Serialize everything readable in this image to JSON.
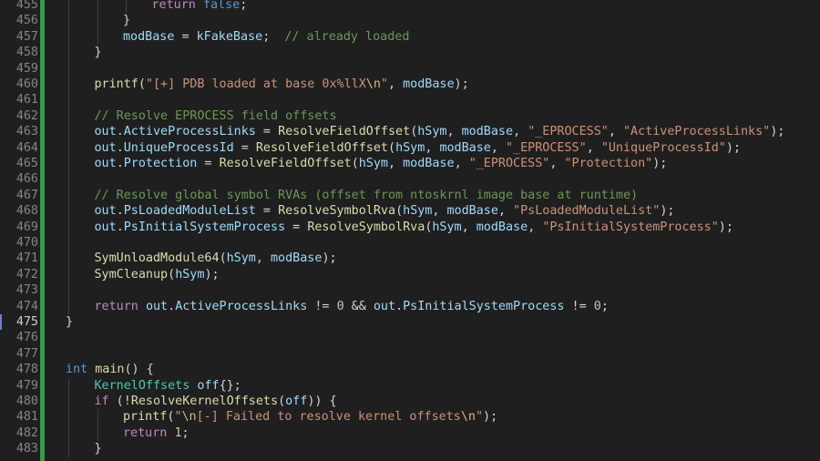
{
  "editor": {
    "git_bar_color": "#2ea043",
    "active_line": "475",
    "lines": [
      {
        "n": "455",
        "indent": 3,
        "tokens": [
          [
            "ctl",
            "return"
          ],
          [
            "plain",
            " "
          ],
          [
            "kw",
            "false"
          ],
          [
            "plain",
            ";"
          ]
        ]
      },
      {
        "n": "456",
        "indent": 2,
        "tokens": [
          [
            "plain",
            "}"
          ]
        ]
      },
      {
        "n": "457",
        "indent": 2,
        "tokens": [
          [
            "var",
            "modBase"
          ],
          [
            "plain",
            " = "
          ],
          [
            "var",
            "kFakeBase"
          ],
          [
            "plain",
            ";  "
          ],
          [
            "com",
            "// already loaded"
          ]
        ]
      },
      {
        "n": "458",
        "indent": 1,
        "tokens": [
          [
            "plain",
            "}"
          ]
        ]
      },
      {
        "n": "459",
        "indent": 0,
        "tokens": []
      },
      {
        "n": "460",
        "indent": 1,
        "tokens": [
          [
            "fn",
            "printf"
          ],
          [
            "plain",
            "("
          ],
          [
            "str",
            "\"[+] PDB loaded at base 0x%llX"
          ],
          [
            "esc",
            "\\n"
          ],
          [
            "str",
            "\""
          ],
          [
            "plain",
            ", "
          ],
          [
            "var",
            "modBase"
          ],
          [
            "plain",
            ");"
          ]
        ]
      },
      {
        "n": "461",
        "indent": 0,
        "tokens": []
      },
      {
        "n": "462",
        "indent": 1,
        "tokens": [
          [
            "com",
            "// Resolve EPROCESS field offsets"
          ]
        ]
      },
      {
        "n": "463",
        "indent": 1,
        "tokens": [
          [
            "var",
            "out"
          ],
          [
            "plain",
            "."
          ],
          [
            "var",
            "ActiveProcessLinks"
          ],
          [
            "plain",
            " = "
          ],
          [
            "fn",
            "ResolveFieldOffset"
          ],
          [
            "plain",
            "("
          ],
          [
            "var",
            "hSym"
          ],
          [
            "plain",
            ", "
          ],
          [
            "var",
            "modBase"
          ],
          [
            "plain",
            ", "
          ],
          [
            "str",
            "\"_EPROCESS\""
          ],
          [
            "plain",
            ", "
          ],
          [
            "str",
            "\"ActiveProcessLinks\""
          ],
          [
            "plain",
            ");"
          ]
        ]
      },
      {
        "n": "464",
        "indent": 1,
        "tokens": [
          [
            "var",
            "out"
          ],
          [
            "plain",
            "."
          ],
          [
            "var",
            "UniqueProcessId"
          ],
          [
            "plain",
            " = "
          ],
          [
            "fn",
            "ResolveFieldOffset"
          ],
          [
            "plain",
            "("
          ],
          [
            "var",
            "hSym"
          ],
          [
            "plain",
            ", "
          ],
          [
            "var",
            "modBase"
          ],
          [
            "plain",
            ", "
          ],
          [
            "str",
            "\"_EPROCESS\""
          ],
          [
            "plain",
            ", "
          ],
          [
            "str",
            "\"UniqueProcessId\""
          ],
          [
            "plain",
            ");"
          ]
        ]
      },
      {
        "n": "465",
        "indent": 1,
        "tokens": [
          [
            "var",
            "out"
          ],
          [
            "plain",
            "."
          ],
          [
            "var",
            "Protection"
          ],
          [
            "plain",
            " = "
          ],
          [
            "fn",
            "ResolveFieldOffset"
          ],
          [
            "plain",
            "("
          ],
          [
            "var",
            "hSym"
          ],
          [
            "plain",
            ", "
          ],
          [
            "var",
            "modBase"
          ],
          [
            "plain",
            ", "
          ],
          [
            "str",
            "\"_EPROCESS\""
          ],
          [
            "plain",
            ", "
          ],
          [
            "str",
            "\"Protection\""
          ],
          [
            "plain",
            ");"
          ]
        ]
      },
      {
        "n": "466",
        "indent": 0,
        "tokens": []
      },
      {
        "n": "467",
        "indent": 1,
        "tokens": [
          [
            "com",
            "// Resolve global symbol RVAs (offset from ntoskrnl image base at runtime)"
          ]
        ]
      },
      {
        "n": "468",
        "indent": 1,
        "tokens": [
          [
            "var",
            "out"
          ],
          [
            "plain",
            "."
          ],
          [
            "var",
            "PsLoadedModuleList"
          ],
          [
            "plain",
            " = "
          ],
          [
            "fn",
            "ResolveSymbolRva"
          ],
          [
            "plain",
            "("
          ],
          [
            "var",
            "hSym"
          ],
          [
            "plain",
            ", "
          ],
          [
            "var",
            "modBase"
          ],
          [
            "plain",
            ", "
          ],
          [
            "str",
            "\"PsLoadedModuleList\""
          ],
          [
            "plain",
            ");"
          ]
        ]
      },
      {
        "n": "469",
        "indent": 1,
        "tokens": [
          [
            "var",
            "out"
          ],
          [
            "plain",
            "."
          ],
          [
            "var",
            "PsInitialSystemProcess"
          ],
          [
            "plain",
            " = "
          ],
          [
            "fn",
            "ResolveSymbolRva"
          ],
          [
            "plain",
            "("
          ],
          [
            "var",
            "hSym"
          ],
          [
            "plain",
            ", "
          ],
          [
            "var",
            "modBase"
          ],
          [
            "plain",
            ", "
          ],
          [
            "str",
            "\"PsInitialSystemProcess\""
          ],
          [
            "plain",
            ");"
          ]
        ]
      },
      {
        "n": "470",
        "indent": 0,
        "tokens": []
      },
      {
        "n": "471",
        "indent": 1,
        "tokens": [
          [
            "fn",
            "SymUnloadModule64"
          ],
          [
            "plain",
            "("
          ],
          [
            "var",
            "hSym"
          ],
          [
            "plain",
            ", "
          ],
          [
            "var",
            "modBase"
          ],
          [
            "plain",
            ");"
          ]
        ]
      },
      {
        "n": "472",
        "indent": 1,
        "tokens": [
          [
            "fn",
            "SymCleanup"
          ],
          [
            "plain",
            "("
          ],
          [
            "var",
            "hSym"
          ],
          [
            "plain",
            ");"
          ]
        ]
      },
      {
        "n": "473",
        "indent": 0,
        "tokens": []
      },
      {
        "n": "474",
        "indent": 1,
        "tokens": [
          [
            "ctl",
            "return"
          ],
          [
            "plain",
            " "
          ],
          [
            "var",
            "out"
          ],
          [
            "plain",
            "."
          ],
          [
            "var",
            "ActiveProcessLinks"
          ],
          [
            "plain",
            " != "
          ],
          [
            "num",
            "0"
          ],
          [
            "plain",
            " && "
          ],
          [
            "var",
            "out"
          ],
          [
            "plain",
            "."
          ],
          [
            "var",
            "PsInitialSystemProcess"
          ],
          [
            "plain",
            " != "
          ],
          [
            "num",
            "0"
          ],
          [
            "plain",
            ";"
          ]
        ]
      },
      {
        "n": "475",
        "indent": 0,
        "tokens": [
          [
            "plain",
            "}"
          ]
        ]
      },
      {
        "n": "476",
        "indent": 0,
        "tokens": []
      },
      {
        "n": "477",
        "indent": 0,
        "tokens": []
      },
      {
        "n": "478",
        "indent": 0,
        "tokens": [
          [
            "kw",
            "int"
          ],
          [
            "plain",
            " "
          ],
          [
            "fn",
            "main"
          ],
          [
            "plain",
            "() {"
          ]
        ]
      },
      {
        "n": "479",
        "indent": 1,
        "tokens": [
          [
            "type",
            "KernelOffsets"
          ],
          [
            "plain",
            " "
          ],
          [
            "var",
            "off"
          ],
          [
            "plain",
            "{};"
          ]
        ]
      },
      {
        "n": "480",
        "indent": 1,
        "tokens": [
          [
            "ctl",
            "if"
          ],
          [
            "plain",
            " (!"
          ],
          [
            "fn",
            "ResolveKernelOffsets"
          ],
          [
            "plain",
            "("
          ],
          [
            "var",
            "off"
          ],
          [
            "plain",
            ")) {"
          ]
        ]
      },
      {
        "n": "481",
        "indent": 2,
        "tokens": [
          [
            "fn",
            "printf"
          ],
          [
            "plain",
            "("
          ],
          [
            "str",
            "\""
          ],
          [
            "esc",
            "\\n"
          ],
          [
            "str",
            "[-] Failed to resolve kernel offsets"
          ],
          [
            "esc",
            "\\n"
          ],
          [
            "str",
            "\""
          ],
          [
            "plain",
            ");"
          ]
        ]
      },
      {
        "n": "482",
        "indent": 2,
        "tokens": [
          [
            "ctl",
            "return"
          ],
          [
            "plain",
            " "
          ],
          [
            "num",
            "1"
          ],
          [
            "plain",
            ";"
          ]
        ]
      },
      {
        "n": "483",
        "indent": 1,
        "tokens": [
          [
            "plain",
            "}"
          ]
        ]
      }
    ]
  }
}
